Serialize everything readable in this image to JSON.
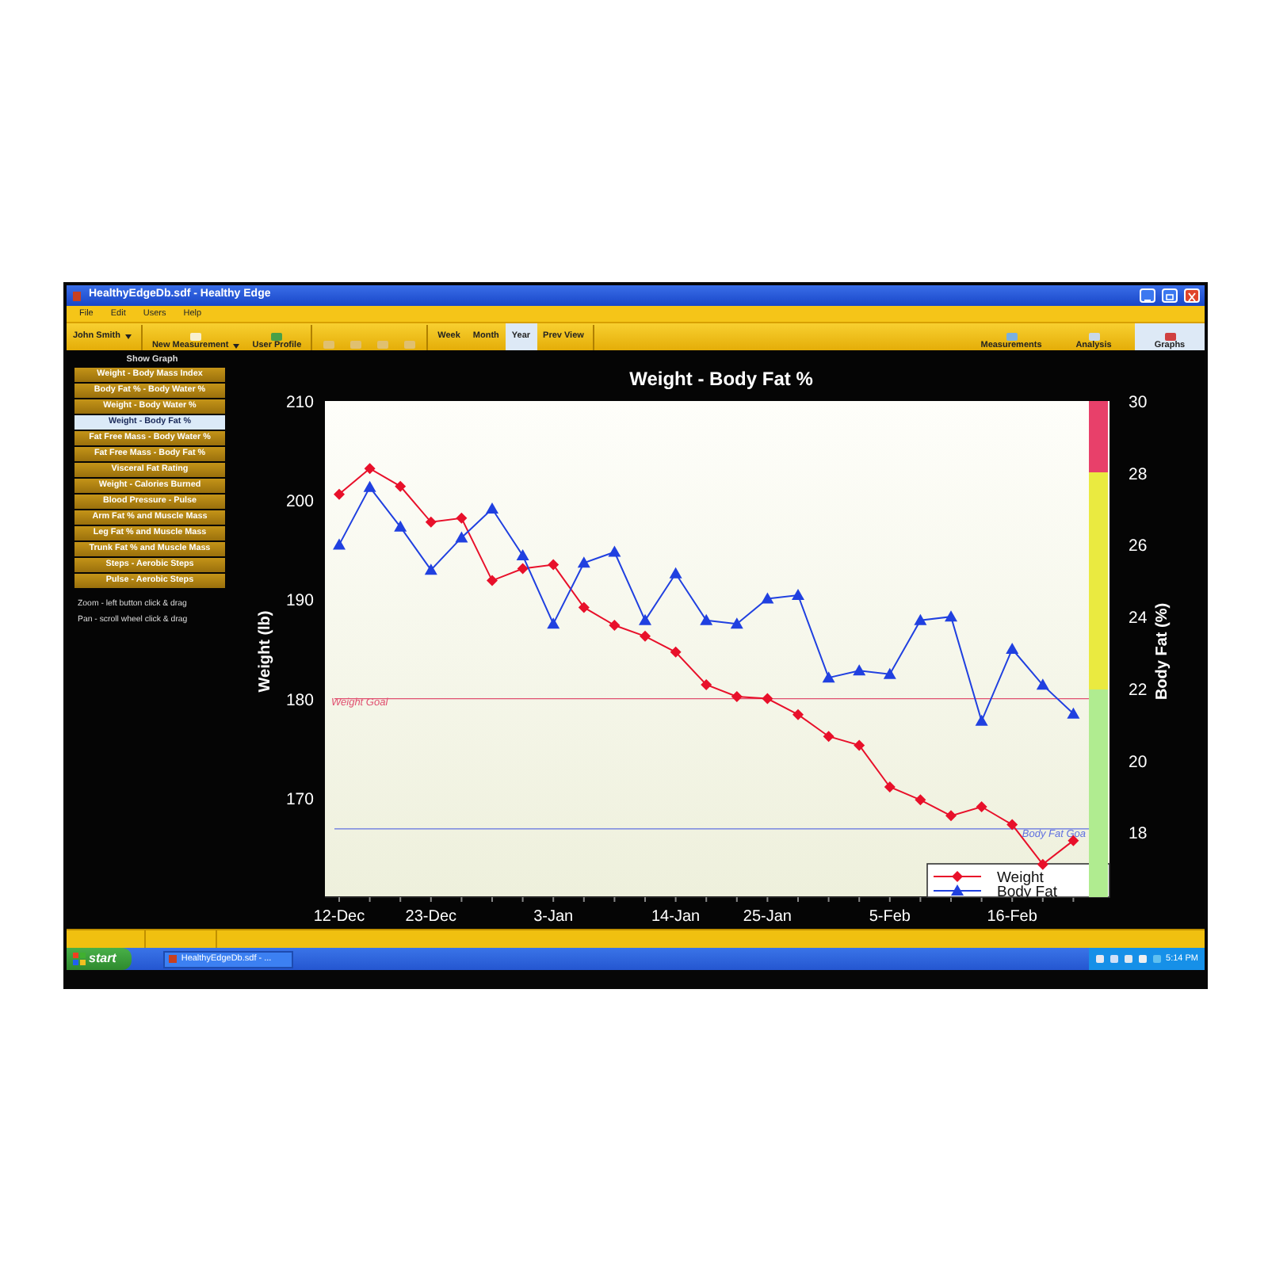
{
  "window": {
    "title": "HealthyEdgeDb.sdf - Healthy Edge"
  },
  "menu": [
    "File",
    "Edit",
    "Users",
    "Help"
  ],
  "toolbar": {
    "items": [
      {
        "kind": "dropdown",
        "label": "John Smith",
        "disabled": false
      },
      {
        "kind": "icon-dropdown",
        "label": "New Measurement",
        "disabled": false
      },
      {
        "kind": "icon",
        "label": "User Profile",
        "disabled": false
      },
      {
        "kind": "icon",
        "disabled": true
      },
      {
        "kind": "icon",
        "disabled": true
      },
      {
        "kind": "icon",
        "disabled": true
      },
      {
        "kind": "icon",
        "disabled": true
      }
    ],
    "periods": [
      {
        "label": "Week",
        "selected": false
      },
      {
        "label": "Month",
        "selected": false
      },
      {
        "label": "Year",
        "selected": true
      }
    ],
    "prev_view": "Prev View",
    "views": [
      {
        "label": "Measurements",
        "selected": false
      },
      {
        "label": "Analysis",
        "selected": false
      },
      {
        "label": "Graphs",
        "selected": true
      }
    ]
  },
  "sidebar": {
    "heading": "Show Graph",
    "items": [
      {
        "label": "Weight - Body Mass Index",
        "selected": false
      },
      {
        "label": "Body Fat % - Body Water %",
        "selected": false
      },
      {
        "label": "Weight - Body Water %",
        "selected": false
      },
      {
        "label": "Weight - Body Fat %",
        "selected": true
      },
      {
        "label": "Fat Free Mass - Body Water %",
        "selected": false
      },
      {
        "label": "Fat Free Mass - Body Fat %",
        "selected": false
      },
      {
        "label": "Visceral Fat Rating",
        "selected": false
      },
      {
        "label": "Weight - Calories Burned",
        "selected": false
      },
      {
        "label": "Blood Pressure - Pulse",
        "selected": false
      },
      {
        "label": "Arm Fat % and Muscle Mass",
        "selected": false
      },
      {
        "label": "Leg Fat % and Muscle Mass",
        "selected": false
      },
      {
        "label": "Trunk Fat % and Muscle Mass",
        "selected": false
      },
      {
        "label": "Steps - Aerobic Steps",
        "selected": false
      },
      {
        "label": "Pulse - Aerobic Steps",
        "selected": false
      }
    ],
    "notes": [
      "Zoom - left button click & drag",
      "Pan - scroll wheel click & drag"
    ]
  },
  "graph": {
    "chart_data": {
      "type": "line",
      "title": "Weight - Body Fat %",
      "ylabel": "Weight (lb)",
      "y2label": "Body Fat (%)",
      "categories": [
        "12-Dec",
        null,
        null,
        "23-Dec",
        null,
        null,
        null,
        "3-Jan",
        null,
        null,
        null,
        "14-Jan",
        null,
        null,
        "25-Jan",
        null,
        null,
        null,
        "5-Feb",
        null,
        null,
        null,
        "16-Feb",
        null,
        null
      ],
      "ylim": [
        160,
        210
      ],
      "y2lim": [
        16.2,
        30
      ],
      "yticks": [
        170,
        180,
        190,
        200,
        210
      ],
      "y2ticks": [
        18,
        20,
        22,
        24,
        26,
        28,
        30
      ],
      "series": [
        {
          "name": "Weight",
          "color": "#e8102a",
          "marker": "diamond",
          "values": [
            200.6,
            203.2,
            201.4,
            197.8,
            198.2,
            191.9,
            193.1,
            193.5,
            189.2,
            187.4,
            186.3,
            184.7,
            181.4,
            180.2,
            180.0,
            178.4,
            176.2,
            175.3,
            171.1,
            169.8,
            168.2,
            169.1,
            167.3,
            163.3,
            165.7
          ]
        },
        {
          "name": "Body Fat",
          "color": "#2040e0",
          "axis": "y2",
          "marker": "triangle",
          "values": [
            26.0,
            27.6,
            26.5,
            25.3,
            26.2,
            27.0,
            25.7,
            23.8,
            25.5,
            25.8,
            23.9,
            25.2,
            23.9,
            23.8,
            24.5,
            24.6,
            22.3,
            22.5,
            22.4,
            23.9,
            24.0,
            21.1,
            23.1,
            22.1,
            21.3
          ]
        }
      ],
      "legend": "lower right",
      "ref_lines": [
        {
          "value": 180,
          "axis": "y",
          "label": "Weight Goal",
          "color": "#e05070"
        },
        {
          "value": 18.1,
          "axis": "y2",
          "label": "Body Fat Goa",
          "color": "#6070e0"
        }
      ]
    },
    "zone_strip": [
      {
        "color": "#e8406a"
      },
      {
        "color": "#eaea40"
      },
      {
        "color": "#b0ec90"
      }
    ]
  },
  "taskbar": {
    "start": "start",
    "task": "HealthyEdgeDb.sdf - ...",
    "clock": "5:14 PM"
  }
}
